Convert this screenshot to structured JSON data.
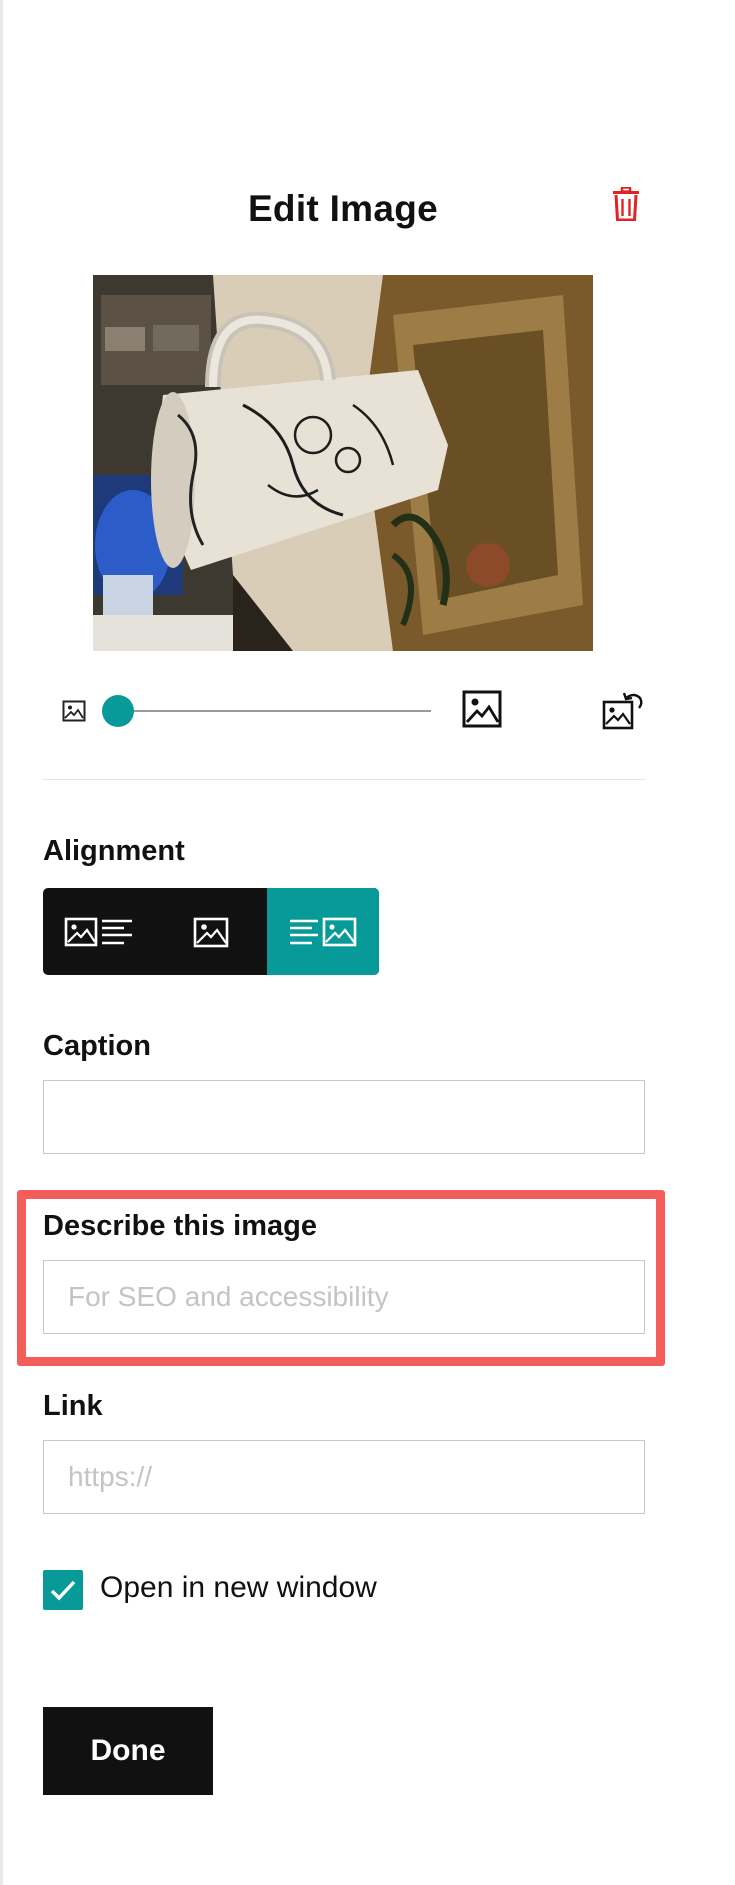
{
  "dialog": {
    "title": "Edit Image",
    "delete_icon": "trash-icon"
  },
  "image": {
    "description": "photo of a white mug with black lace pattern next to a wooden frame"
  },
  "zoom": {
    "min_icon": "image-small-icon",
    "max_icon": "image-large-icon",
    "rotate_icon": "rotate-image-icon",
    "value": 0
  },
  "alignment": {
    "label": "Alignment",
    "options": [
      {
        "name": "image-left-text-right",
        "icon": "align-image-left-icon",
        "active": false
      },
      {
        "name": "image-center",
        "icon": "align-image-center-icon",
        "active": false
      },
      {
        "name": "text-left-image-right",
        "icon": "align-image-right-icon",
        "active": true
      }
    ]
  },
  "caption": {
    "label": "Caption",
    "value": "",
    "placeholder": ""
  },
  "describe": {
    "label": "Describe this image",
    "value": "",
    "placeholder": "For SEO and accessibility"
  },
  "link": {
    "label": "Link",
    "value": "",
    "placeholder": "https://"
  },
  "open_new_window": {
    "label": "Open in new window",
    "checked": true
  },
  "actions": {
    "done_label": "Done"
  },
  "colors": {
    "accent": "#089a98",
    "danger": "#e02424",
    "highlight": "#f35e5a",
    "button_dark": "#111111"
  }
}
